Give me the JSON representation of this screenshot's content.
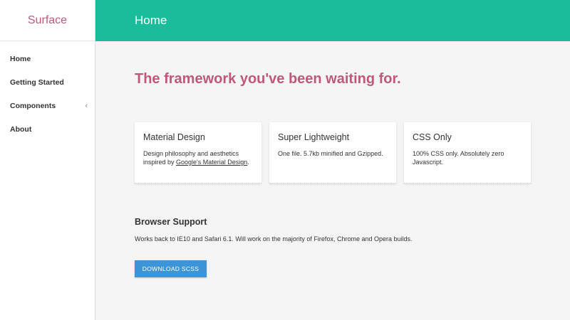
{
  "brand": {
    "name": "Surface"
  },
  "sidebar": {
    "items": [
      {
        "label": "Home"
      },
      {
        "label": "Getting Started"
      },
      {
        "label": "Components",
        "chevron": "‹"
      },
      {
        "label": "About"
      }
    ]
  },
  "header": {
    "title": "Home"
  },
  "main": {
    "headline": "The framework you've been waiting for.",
    "cards": [
      {
        "title": "Material Design",
        "text_before": "Design philosophy and aesthetics inspired by ",
        "link": "Google's Material Design",
        "text_after": "."
      },
      {
        "title": "Super Lightweight",
        "text": "One file. 5.7kb minified and Gzipped."
      },
      {
        "title": "CSS Only",
        "text": "100% CSS only. Absolutely zero Javascript."
      }
    ],
    "browser_support": {
      "title": "Browser Support",
      "text": "Works back to IE10 and Safari 6.1. Will work on the majority of Firefox, Chrome and Opera builds."
    },
    "download_label": "DOWNLOAD SCSS"
  },
  "colors": {
    "accent_teal": "#1abc9c",
    "brand_pink": "#c0587e",
    "button_blue": "#3d95d8"
  }
}
